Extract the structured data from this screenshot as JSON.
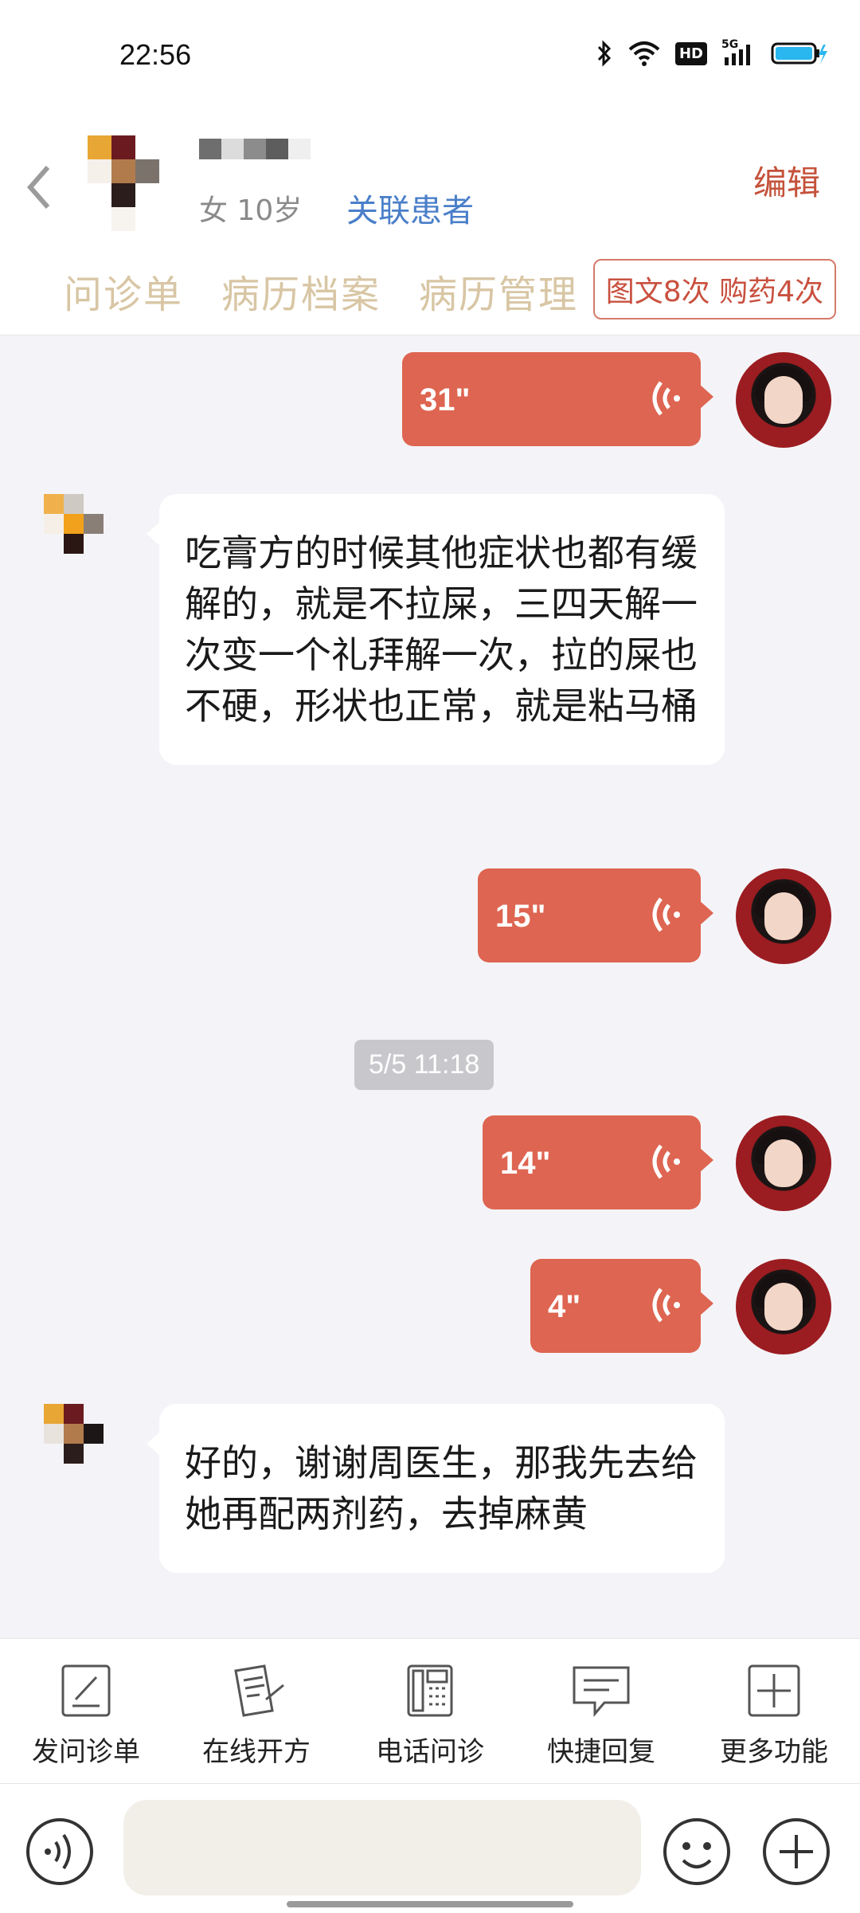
{
  "status": {
    "time": "22:56",
    "hd": "HD",
    "net": "5G"
  },
  "header": {
    "patient_info": "女 10岁",
    "link_label": "关联患者",
    "edit_label": "编辑",
    "tabs": [
      "问诊单",
      "病历档案",
      "病历管理"
    ],
    "counter": "图文8次 购药4次"
  },
  "messages": [
    {
      "type": "voice",
      "from": "doctor",
      "duration": "31\""
    },
    {
      "type": "text",
      "from": "patient",
      "text": "吃膏方的时候其他症状也都有缓解的，就是不拉屎，三四天解一次变一个礼拜解一次，拉的屎也不硬，形状也正常，就是粘马桶"
    },
    {
      "type": "voice",
      "from": "doctor",
      "duration": "15\""
    },
    {
      "type": "time",
      "text": "5/5 11:18"
    },
    {
      "type": "voice",
      "from": "doctor",
      "duration": "14\""
    },
    {
      "type": "voice",
      "from": "doctor",
      "duration": "4\""
    },
    {
      "type": "text",
      "from": "patient",
      "text": "好的，谢谢周医生，那我先去给她再配两剂药，去掉麻黄"
    }
  ],
  "toolbar": [
    {
      "label": "发问诊单",
      "icon": "edit-form-icon"
    },
    {
      "label": "在线开方",
      "icon": "prescription-icon"
    },
    {
      "label": "电话问诊",
      "icon": "phone-icon"
    },
    {
      "label": "快捷回复",
      "icon": "chat-icon"
    },
    {
      "label": "更多功能",
      "icon": "plus-box-icon"
    }
  ],
  "input": {
    "placeholder": ""
  },
  "colors": {
    "accent": "#de6551",
    "link": "#4a7fc9",
    "tab": "#d8c6a4"
  }
}
